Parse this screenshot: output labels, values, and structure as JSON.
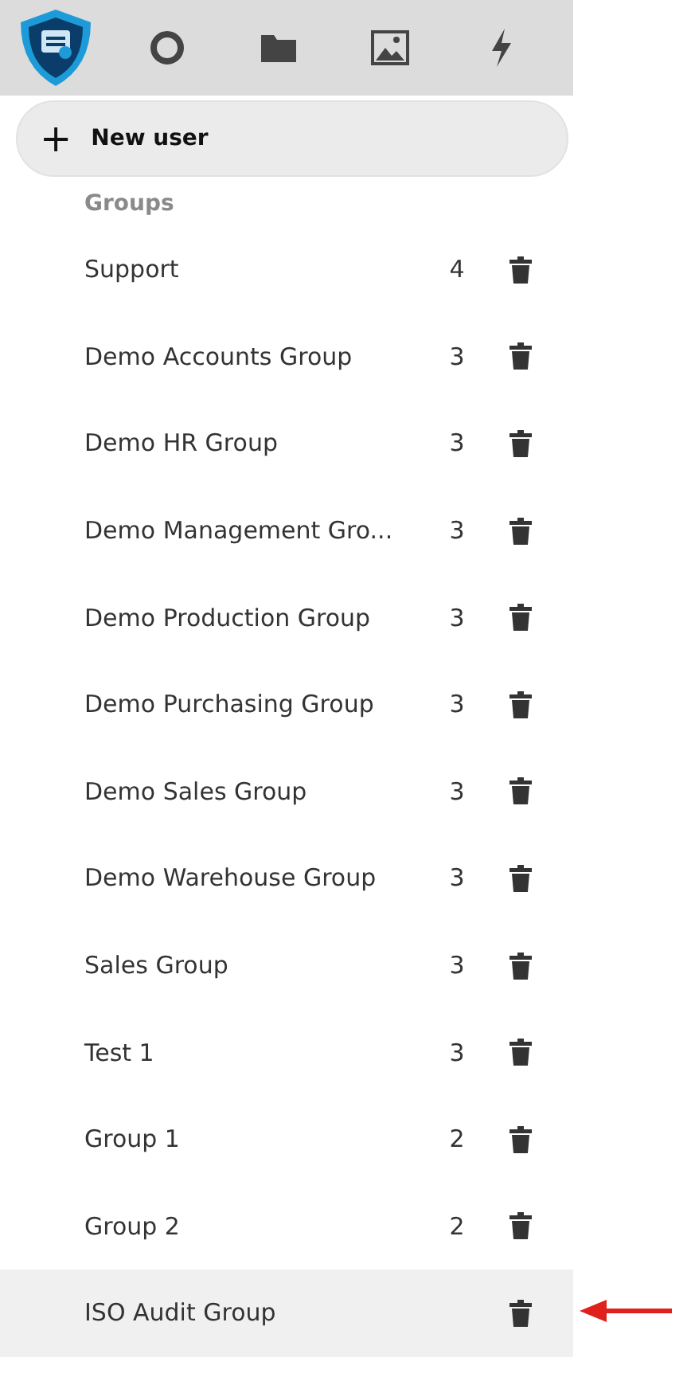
{
  "toolbar": {
    "items": [
      {
        "kind": "logo"
      },
      {
        "kind": "circle"
      },
      {
        "kind": "folder"
      },
      {
        "kind": "image"
      },
      {
        "kind": "bolt"
      }
    ]
  },
  "new_user_button": {
    "icon": "+",
    "label": "New user"
  },
  "groups": {
    "heading": "Groups",
    "rows": [
      {
        "name": "Support",
        "count": "4",
        "highlighted": false
      },
      {
        "name": "Demo Accounts Group",
        "count": "3",
        "highlighted": false
      },
      {
        "name": "Demo HR Group",
        "count": "3",
        "highlighted": false
      },
      {
        "name": "Demo Management Gro...",
        "count": "3",
        "highlighted": false
      },
      {
        "name": "Demo Production Group",
        "count": "3",
        "highlighted": false
      },
      {
        "name": "Demo Purchasing Group",
        "count": "3",
        "highlighted": false
      },
      {
        "name": "Demo Sales Group",
        "count": "3",
        "highlighted": false
      },
      {
        "name": "Demo Warehouse Group",
        "count": "3",
        "highlighted": false
      },
      {
        "name": "Sales Group",
        "count": "3",
        "highlighted": false
      },
      {
        "name": "Test 1",
        "count": "3",
        "highlighted": false
      },
      {
        "name": "Group 1",
        "count": "2",
        "highlighted": false
      },
      {
        "name": "Group 2",
        "count": "2",
        "highlighted": false
      },
      {
        "name": "ISO Audit Group",
        "highlighted": true,
        "pointer_arrow": true
      }
    ]
  }
}
